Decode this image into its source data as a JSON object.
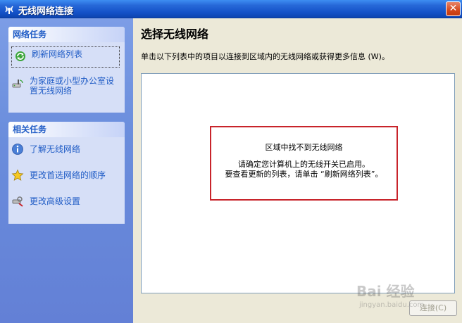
{
  "window": {
    "title": "无线网络连接",
    "close_glyph": "✕"
  },
  "sidebar": {
    "network_tasks": {
      "header": "网络任务",
      "items": [
        {
          "label": "刷新网络列表",
          "icon": "refresh-icon"
        },
        {
          "label": "为家庭或小型办公室设置无线网络",
          "line1": "为家庭或小型办公室设",
          "line2": "置无线网络",
          "icon": "wireless-setup-icon"
        }
      ]
    },
    "related_tasks": {
      "header": "相关任务",
      "items": [
        {
          "label": "了解无线网络",
          "icon": "info-icon"
        },
        {
          "label": "更改首选网络的顺序",
          "icon": "star-icon"
        },
        {
          "label": "更改高级设置",
          "icon": "settings-icon"
        }
      ]
    }
  },
  "main": {
    "heading": "选择无线网络",
    "description": "单击以下列表中的项目以连接到区域内的无线网络或获得更多信息 (W)。",
    "message": {
      "title": "区域中找不到无线网络",
      "line1": "请确定您计算机上的无线开关已启用。",
      "line2": "要查看更新的列表，请单击 “刷新网络列表”。"
    },
    "connect_button": "连接(C)"
  },
  "watermark": {
    "brand": "Bai 经验",
    "url": "jingyan.baidu.com"
  },
  "colors": {
    "titlebar": "#1452c8",
    "sidebar": "#6a8ddc",
    "panel_header_text": "#215dc6",
    "message_border": "#c8242b"
  }
}
